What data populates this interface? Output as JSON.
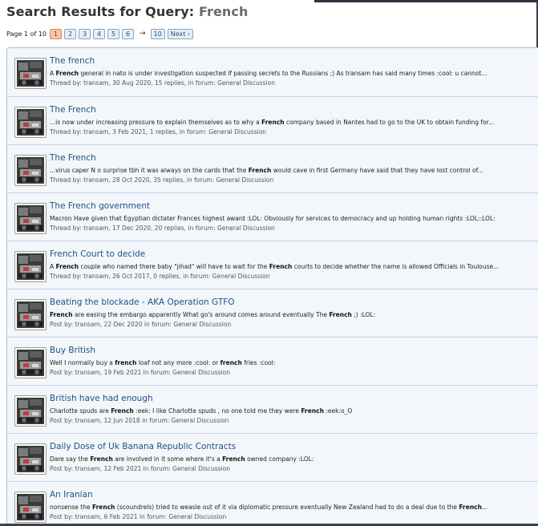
{
  "page_title_prefix": "Search Results for Query:",
  "query": "French",
  "pager": {
    "label": "Page 1 of 10",
    "pages": [
      "1",
      "2",
      "3",
      "4",
      "5",
      "6"
    ],
    "current": "1",
    "dash": "→",
    "last": "10",
    "next": "Next ›"
  },
  "results": [
    {
      "title": "The french",
      "snippet": [
        "A ",
        "French",
        " general in nato is under investigation suspected if passing secrets to the Russians ;) As transam has said many times :cool: u cannot..."
      ],
      "meta": "Thread by: transam, 30 Aug 2020, 15 replies, in forum: General Discussion"
    },
    {
      "title": "The French",
      "snippet": [
        "...is now under increasing pressure to explain themselves as to why a ",
        "French",
        " company based in Nantes had to go to the UK to obtain funding for..."
      ],
      "meta": "Thread by: transam, 3 Feb 2021, 1 replies, in forum: General Discussion"
    },
    {
      "title": "The French",
      "snippet": [
        "...virus caper N o surprise tbh it was always on the cards that the ",
        "French",
        " would cave in first Germany have said that they have lost control of..."
      ],
      "meta": "Thread by: transam, 28 Oct 2020, 35 replies, in forum: General Discussion"
    },
    {
      "title": "The French government",
      "snippet": [
        "Macron Have given that Egyptian dictater Frances highest award :LOL: Obviously for services to democracy and up holding human rights :LOL::LOL:"
      ],
      "meta": "Thread by: transam, 17 Dec 2020, 20 replies, in forum: General Discussion"
    },
    {
      "title": "French Court to decide",
      "snippet": [
        "A ",
        "French",
        " couple who named there baby \"jihad\" will have to wait for the ",
        "French",
        " courts to decide whether the name is allowed Officials in Toulouse..."
      ],
      "meta": "Thread by: transam, 26 Oct 2017, 0 replies, in forum: General Discussion"
    },
    {
      "title": "Beating the blockade - AKA Operation GTFO",
      "snippet": [
        "",
        "French",
        " are easing the embargo apparently What go's around comes around eventually The ",
        "French",
        " ;) :LOL:"
      ],
      "meta": "Post by: transam, 22 Dec 2020 in forum: General Discussion"
    },
    {
      "title": "Buy British",
      "snippet": [
        "Well I normally buy a ",
        "french",
        " loaf not any more :cool: or ",
        "french",
        " fries :cool:"
      ],
      "meta": "Post by: transam, 19 Feb 2021 in forum: General Discussion"
    },
    {
      "title": "British have had enough",
      "snippet": [
        "Charlotte spuds are ",
        "French",
        " :eek: I like Charlotte spuds , no one told me they were ",
        "French",
        " :eek:o_O"
      ],
      "meta": "Post by: transam, 12 Jun 2018 in forum: General Discussion"
    },
    {
      "title": "Daily Dose of Uk Banana Republic Contracts",
      "snippet": [
        "Dare say the ",
        "French",
        " are involved in it some where it's a ",
        "French",
        " owned company :LOL:"
      ],
      "meta": "Post by: transam, 12 Feb 2021 in forum: General Discussion"
    },
    {
      "title": "An Iranian",
      "snippet": [
        "nonsense the ",
        "French",
        " (scoundrels) tried to weasle out of it via diplomatic pressure eventually New Zealand had to do a deal due to the ",
        "French",
        "..."
      ],
      "meta": "Post by: transam, 6 Feb 2021 in forum: General Discussion"
    }
  ]
}
